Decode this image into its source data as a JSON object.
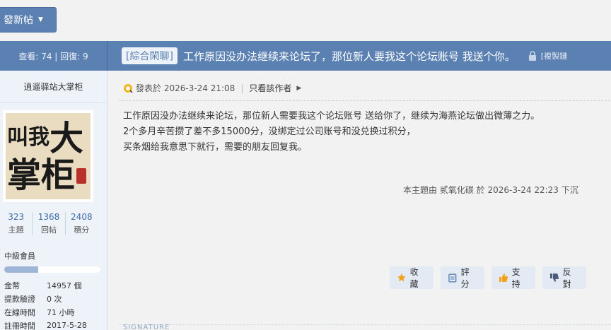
{
  "toolbar": {
    "new_post_label": "發新帖"
  },
  "thread": {
    "stats": "查看: 74 | 回復: 9",
    "tag": "[綜合閑聊]",
    "title": "工作原因没办法继续来论坛了，那位新人要我这个论坛账号 我送个你。",
    "copy_link": "[複製鏈"
  },
  "user": {
    "name": "逍遥驿站大掌柜",
    "avatar_text": "叫我大掌柜",
    "counts": [
      {
        "num": "323",
        "label": "主題"
      },
      {
        "num": "1368",
        "label": "回帖"
      },
      {
        "num": "2408",
        "label": "積分"
      }
    ],
    "rank": "中級會員",
    "rank_progress": 0.35,
    "info": [
      {
        "key": "金幣",
        "value": "14957 個"
      },
      {
        "key": "提款驗證",
        "value": "0 次"
      },
      {
        "key": "在線時間",
        "value": "71 小時"
      },
      {
        "key": "註冊時間",
        "value": "2017-5-28"
      }
    ]
  },
  "post": {
    "posted": "發表於 2026-3-24 21:08",
    "only_author": "只看該作者",
    "lines": [
      "工作原因没办法继续来论坛，那位新人需要我这个论坛账号 送给你了，继续为海燕论坛做出微薄之力。",
      "2个多月辛苦攒了差不多15000分，没绑定过公司账号和没兑换过积分，",
      "买条烟给我意思下就行，需要的朋友回复我。"
    ],
    "moved_note": "本主題由 贰氧化碳 於 2026-3-24 22:23 下沉"
  },
  "actions": {
    "favorite": "收藏",
    "rate": "評分",
    "support": "支持",
    "oppose": "反對"
  },
  "signature_label": "SIGNATURE",
  "colors": {
    "accent": "#5b80b2",
    "sidebar": "#eef3fa",
    "link": "#3c6aa8"
  }
}
